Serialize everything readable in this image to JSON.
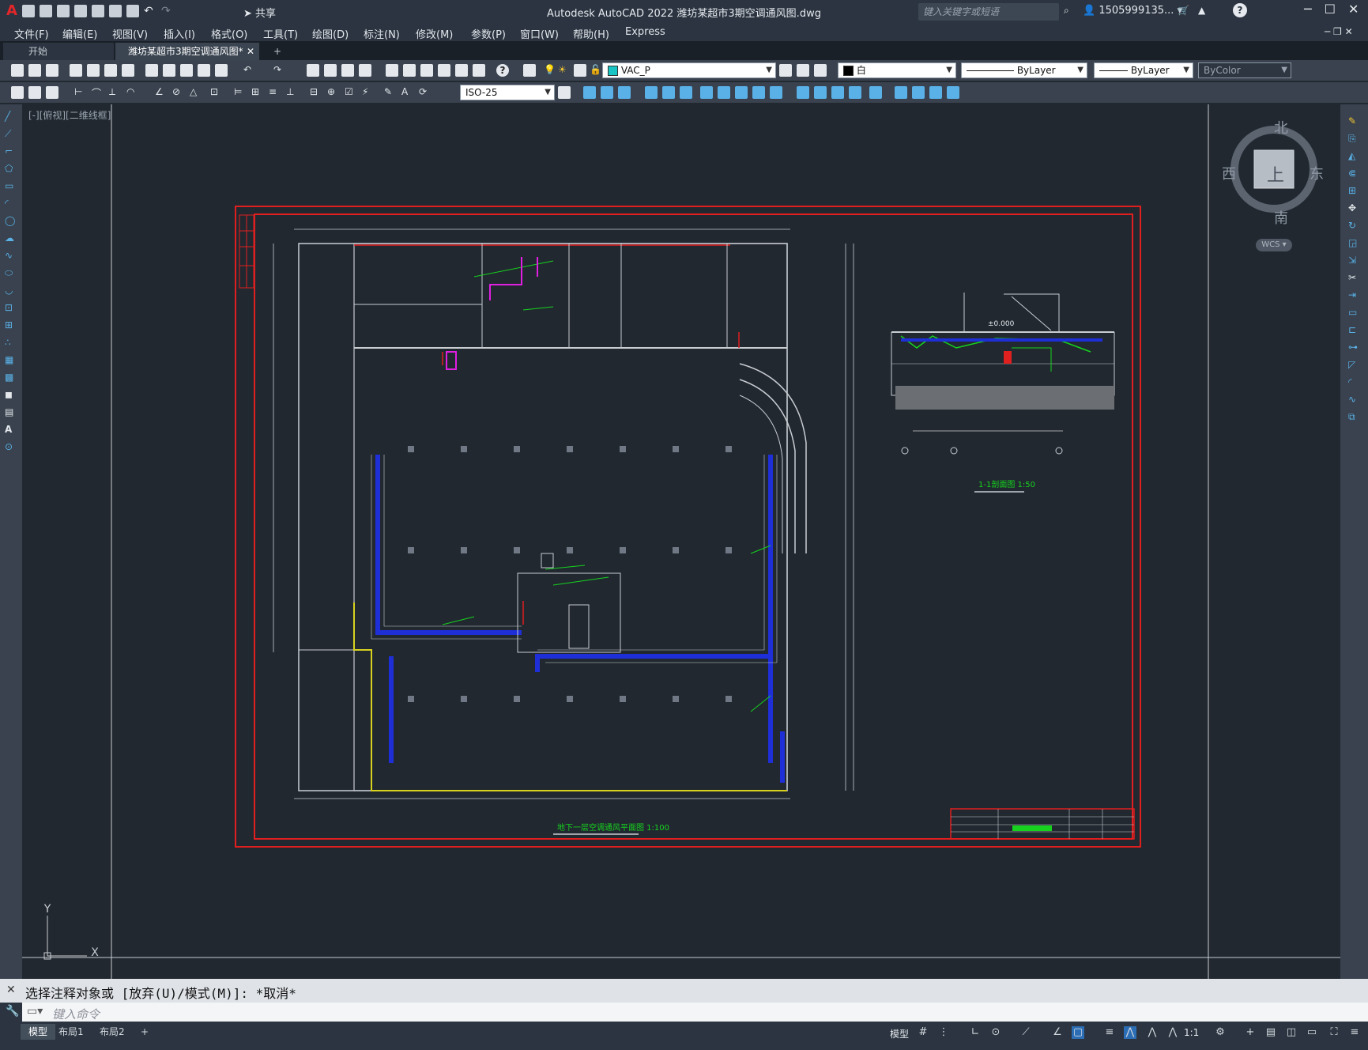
{
  "app": {
    "title": "Autodesk AutoCAD 2022    潍坊某超市3期空调通风图.dwg",
    "logo": "A",
    "share_label": "共享",
    "search_placeholder": "键入关键字或短语",
    "user": "1505999135...",
    "help": "?"
  },
  "menu": [
    "文件(F)",
    "编辑(E)",
    "视图(V)",
    "插入(I)",
    "格式(O)",
    "工具(T)",
    "绘图(D)",
    "标注(N)",
    "修改(M)",
    "参数(P)",
    "窗口(W)",
    "帮助(H)",
    "Express"
  ],
  "tabs": {
    "start": "开始",
    "drawing": "潍坊某超市3期空调通风图*",
    "close": "✕",
    "add": "+"
  },
  "toolbar": {
    "layer": "VAC_P",
    "color": "白",
    "linetype": "ByLayer",
    "lineweight": "ByLayer",
    "plotstyle": "ByColor",
    "dimstyle": "ISO-25"
  },
  "view_label": "[-][俯视][二维线框]",
  "viewcube": {
    "north": "北",
    "south": "南",
    "east": "东",
    "west": "西",
    "top": "上",
    "wcs": "WCS"
  },
  "ucs": {
    "x": "X",
    "y": "Y"
  },
  "drawing": {
    "plan_title": "地下一层空调通风平面图 1:100",
    "section_title": "1-1剖面图 1:50",
    "section_elev": "±0.000",
    "color_red": "#e01f1f",
    "color_blue": "#1f2fd8",
    "color_green": "#16d21e",
    "color_magenta": "#e01fe0",
    "color_yellow": "#d8d21e",
    "color_white": "#c9cdd2"
  },
  "command": {
    "history": "选择注释对象或 [放弃(U)/模式(M)]: *取消*",
    "input_placeholder": "键入命令"
  },
  "status": {
    "model_tab": "模型",
    "layout1": "布局1",
    "layout2": "布局2",
    "add": "+",
    "model_btn": "模型",
    "scale": "1:1"
  }
}
